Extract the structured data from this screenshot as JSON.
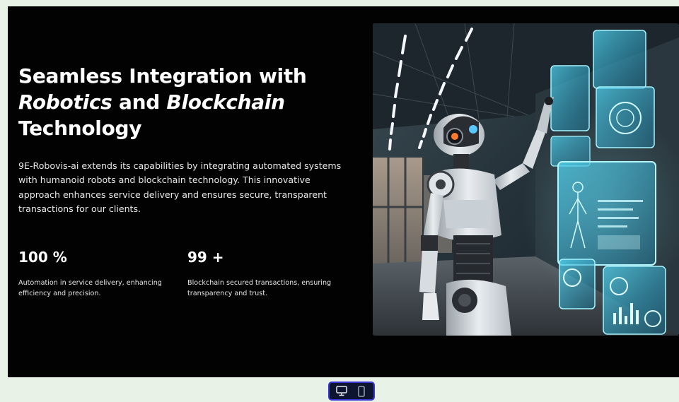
{
  "section": {
    "heading": {
      "line1": "Seamless Integration with",
      "robotics": "Robotics",
      "and": "and",
      "blockchain": "Blockchain",
      "line3": "Technology"
    },
    "description": "9E-Robovis-ai extends its capabilities by integrating automated systems with humanoid robots and blockchain technology. This innovative approach enhances service delivery and ensures secure, transparent transactions for our clients.",
    "stats": [
      {
        "value": "100 %",
        "text": "Automation in service delivery, enhancing efficiency and precision."
      },
      {
        "value": "99 +",
        "text": "Blockchain secured transactions, ensuring transparency and trust."
      }
    ]
  },
  "device_toggle": {
    "options": [
      "desktop-icon",
      "mobile-icon"
    ],
    "active": "desktop"
  },
  "colors": {
    "section_background": "#020202",
    "page_background": "#e9f2e6",
    "toggle_background": "#0c1430",
    "toggle_border": "#3b37d6",
    "hologram_cyan": "#5fe3ff"
  }
}
